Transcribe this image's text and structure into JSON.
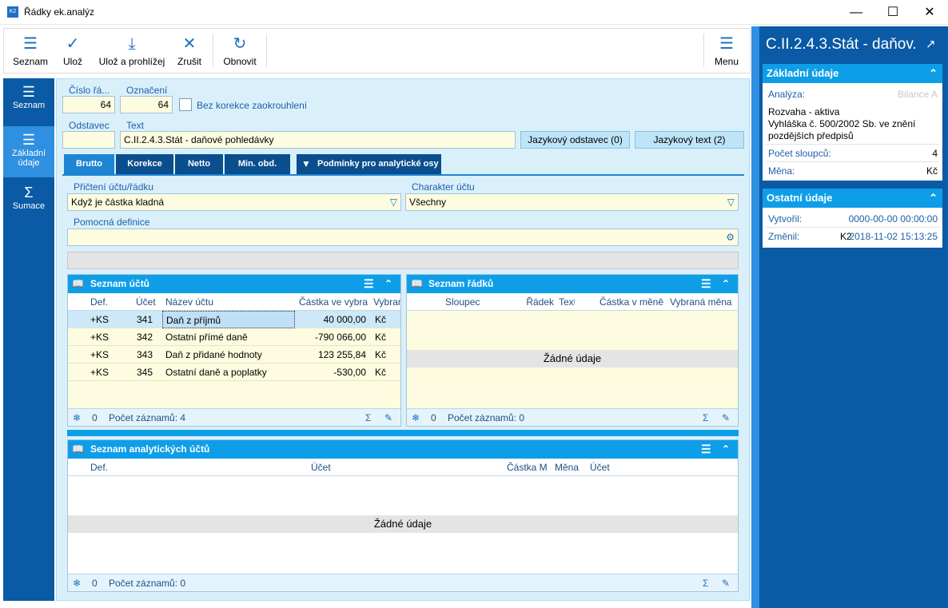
{
  "window": {
    "title": "Řádky ek.analýz"
  },
  "toolbar": {
    "seznam": "Seznam",
    "uloz": "Ulož",
    "uloz_prohlizej": "Ulož a prohlížej",
    "zrusit": "Zrušit",
    "obnovit": "Obnovit",
    "menu": "Menu"
  },
  "nav": {
    "seznam": "Seznam",
    "zakladni_1": "Základní",
    "zakladni_2": "údaje",
    "sumace": "Sumace"
  },
  "form": {
    "cislo_label": "Číslo řá...",
    "cislo_value": "64",
    "oznaceni_label": "Označení",
    "oznaceni_value": "64",
    "bez_korekce_label": "Bez korekce zaokrouhlení",
    "odstavec_label": "Odstavec",
    "odstavec_value": "",
    "text_label": "Text",
    "text_value": "C.II.2.4.3.Stát - daňové pohledávky",
    "jazykovy_odstavec": "Jazykový odstavec (0)",
    "jazykovy_text": "Jazykový text (2)"
  },
  "tabs": [
    "Brutto",
    "Korekce",
    "Netto",
    "Min. obd.",
    "Podmínky pro analytické osy"
  ],
  "brutto": {
    "pricteni_label": "Přičtení účtu/řádku",
    "pricteni_value": "Když je částka kladná",
    "charakter_label": "Charakter účtu",
    "charakter_value": "Všechny",
    "pomocna_label": "Pomocná definice",
    "pomocna_value": ""
  },
  "ucty": {
    "title": "Seznam účtů",
    "headers": [
      "Def.",
      "Účet",
      "Název účtu",
      "Částka ve vybra",
      "Vybran"
    ],
    "rows": [
      {
        "def": "+KS",
        "ucet": "341",
        "nazev": "Daň z příjmů",
        "castka": "40 000,00",
        "mena": "Kč"
      },
      {
        "def": "+KS",
        "ucet": "342",
        "nazev": "Ostatní přímé daně",
        "castka": "-790 066,00",
        "mena": "Kč"
      },
      {
        "def": "+KS",
        "ucet": "343",
        "nazev": "Daň z přidané hodnoty",
        "castka": "123 255,84",
        "mena": "Kč"
      },
      {
        "def": "+KS",
        "ucet": "345",
        "nazev": "Ostatní daně a poplatky",
        "castka": "-530,00",
        "mena": "Kč"
      }
    ],
    "footer_count_icon": "0",
    "footer_text": "Počet záznamů: 4"
  },
  "radky": {
    "title": "Seznam řádků",
    "headers": [
      "Sloupec",
      "Řádek",
      "Text",
      "Částka v měně",
      "Vybraná měna"
    ],
    "empty": "Žádné údaje",
    "footer_count_icon": "0",
    "footer_text": "Počet záznamů: 0"
  },
  "analyticke": {
    "title": "Seznam analytických účtů",
    "headers": [
      "Def.",
      "Účet",
      "Částka M",
      "Měna",
      "Účet"
    ],
    "empty": "Žádné údaje",
    "footer_count_icon": "0",
    "footer_text": "Počet záznamů: 0"
  },
  "right": {
    "title": "C.II.2.4.3.Stát - daňov...",
    "zakladni": {
      "title": "Základní údaje",
      "analyza_label": "Analýza:",
      "analyza_value": "Bilance A",
      "desc1": "Rozvaha - aktiva",
      "desc2": "Vyhláška č. 500/2002 Sb. ve znění",
      "desc3": "pozdějších předpisů",
      "sloupcu_label": "Počet sloupců:",
      "sloupcu_value": "4",
      "mena_label": "Měna:",
      "mena_value": "Kč"
    },
    "ostatni": {
      "title": "Ostatní údaje",
      "vytvoril_label": "Vytvořil:",
      "vytvoril_value": "0000-00-00 00:00:00",
      "zmenil_label": "Změnil:",
      "zmenil_user": "K2",
      "zmenil_value": "2018-11-02 15:13:25"
    }
  }
}
